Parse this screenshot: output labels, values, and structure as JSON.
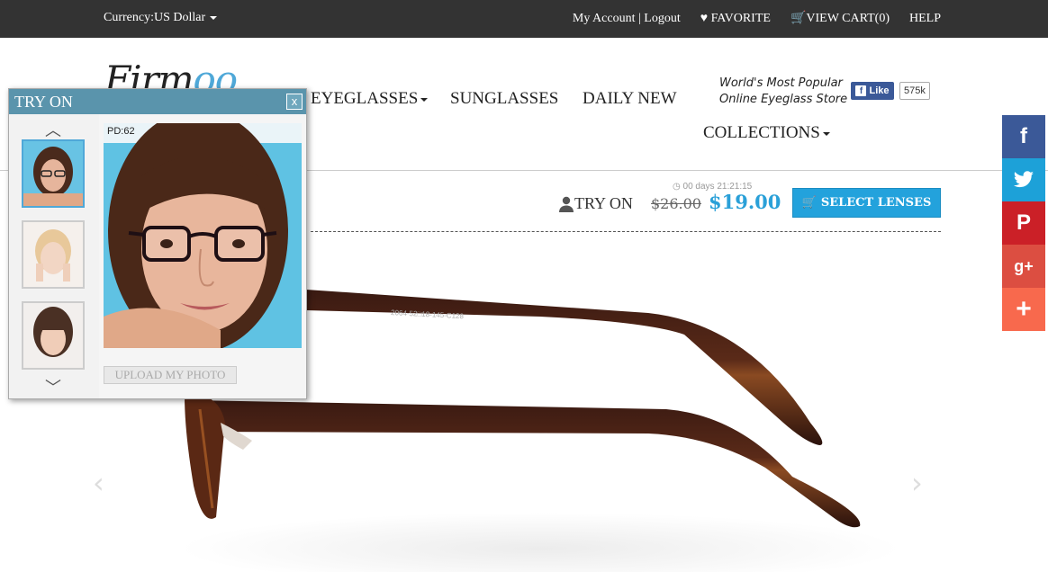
{
  "topbar": {
    "currency": "Currency:US Dollar",
    "account": "My Account",
    "separator": "|",
    "logout": "Logout",
    "favorite": "FAVORITE",
    "cart": "VIEW CART(0)",
    "help": "HELP"
  },
  "header": {
    "logo": "Firm",
    "logo_accent": "oo",
    "nav": [
      "EYEGLASSES",
      "SUNGLASSES",
      "DAILY NEW",
      "COLLECTIONS"
    ],
    "tagline_1": "World's Most Popular",
    "tagline_2": "Online Eyeglass Store",
    "fb_like": "Like",
    "fb_count": "575k"
  },
  "product": {
    "timer": "00 days 21:21:15",
    "try_on": "TRY ON",
    "old_price": "$26.00",
    "new_price": "$19.00",
    "select_lenses": "SELECT LENSES",
    "frame_code": "2064-52□18-145-C128"
  },
  "panel": {
    "title": "TRY ON",
    "close": "x",
    "pd": "PD:62",
    "upload": "UPLOAD MY PHOTO"
  },
  "social": [
    "f",
    "t",
    "P",
    "g+",
    "+"
  ],
  "colors": {
    "accent": "#23a2dc",
    "topbar": "#333333",
    "panel_header": "#5a94ac",
    "facebook": "#3b5998",
    "twitter": "#1da1d8",
    "pinterest": "#cb2027",
    "googleplus": "#dc4e41",
    "addthis": "#f8694d"
  }
}
